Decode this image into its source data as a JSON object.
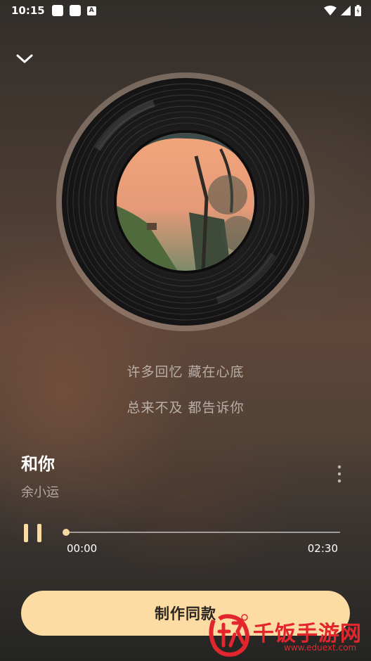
{
  "status_bar": {
    "time": "10:15",
    "notif_a_label": "A"
  },
  "player": {
    "lyrics": [
      "许多回忆 藏在心底",
      "总来不及 都告诉你"
    ],
    "song_title": "和你",
    "artist": "余小运",
    "current_time": "00:00",
    "total_time": "02:30",
    "progress": 0,
    "state": "playing",
    "make_button_label": "制作同款"
  },
  "watermark": {
    "brand": "千饭手游网",
    "url": "www.eduext.com"
  },
  "colors": {
    "accent": "#fcdca3",
    "progress": "#f6d8a0",
    "watermark": "#e3262d"
  },
  "icons": {
    "collapse": "chevron-down-icon",
    "more": "more-vertical-icon",
    "pause": "pause-icon",
    "wifi": "wifi-icon",
    "signal": "signal-icon",
    "battery": "battery-icon"
  }
}
